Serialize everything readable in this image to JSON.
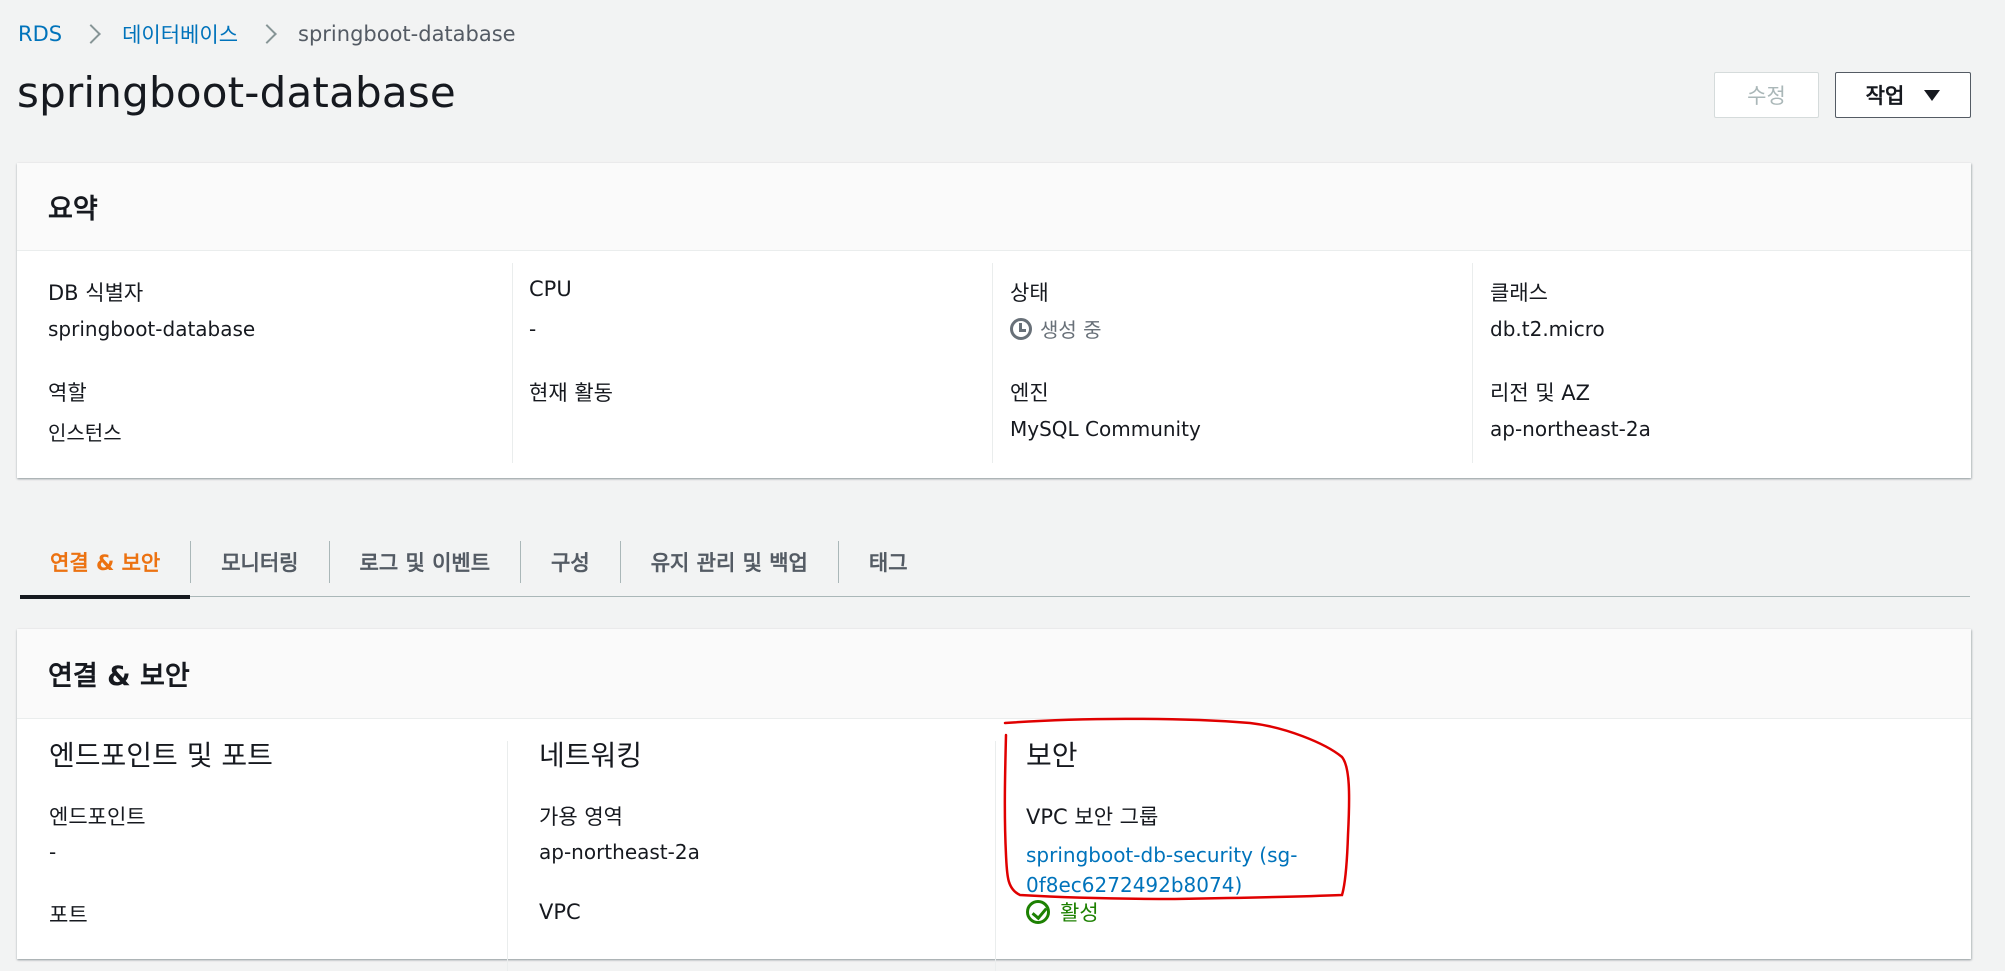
{
  "breadcrumb": {
    "items": [
      "RDS",
      "데이터베이스"
    ],
    "current": "springboot-database"
  },
  "page": {
    "title": "springboot-database",
    "modify_label": "수정",
    "action_label": "작업"
  },
  "summary": {
    "header": "요약",
    "db_id_label": "DB 식별자",
    "db_id_value": "springboot-database",
    "role_label": "역할",
    "role_value": "인스턴스",
    "cpu_label": "CPU",
    "cpu_value": "-",
    "activity_label": "현재 활동",
    "status_label": "상태",
    "status_value": "생성 중",
    "engine_label": "엔진",
    "engine_value": "MySQL Community",
    "class_label": "클래스",
    "class_value": "db.t2.micro",
    "region_label": "리전 및 AZ",
    "region_value": "ap-northeast-2a"
  },
  "tabs": [
    "연결 & 보안",
    "모니터링",
    "로그 및 이벤트",
    "구성",
    "유지 관리 및 백업",
    "태그"
  ],
  "connection": {
    "header": "연결 & 보안",
    "endpoint_section": "엔드포인트 및 포트",
    "endpoint_label": "엔드포인트",
    "endpoint_value": "-",
    "port_label": "포트",
    "network_section": "네트워킹",
    "az_label": "가용 영역",
    "az_value": "ap-northeast-2a",
    "vpc_label": "VPC",
    "security_section": "보안",
    "sg_label": "VPC 보안 그룹",
    "sg_link_line1": "springboot-db-security (sg-",
    "sg_link_line2": "0f8ec6272492b8074)",
    "sg_status": "활성"
  },
  "colors": {
    "link": "#0073bb",
    "active_tab": "#ec7211",
    "ok": "#1d8102",
    "annotation": "#e00000"
  }
}
